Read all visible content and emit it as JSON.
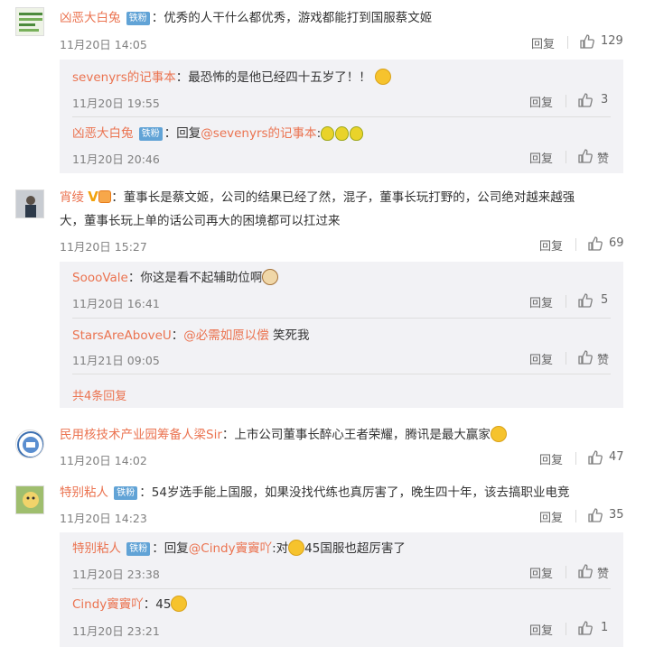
{
  "actions": {
    "reply": "回复",
    "like_text": "赞"
  },
  "comments": [
    {
      "user": "凶恶大白兔",
      "badge": "铁粉",
      "text": "优秀的人干什么都优秀，游戏都能打到国服蔡文姬",
      "time": "11月20日 14:05",
      "likes": "129",
      "replies": [
        {
          "user": "sevenyrs的记事本",
          "text": "最恐怖的是他已经四十五岁了！！",
          "time": "11月20日 19:55",
          "likes": "3"
        },
        {
          "user": "凶恶大白兔",
          "badge": "铁粉",
          "prefix": "回复",
          "at": "@sevenyrs的记事本",
          "text": ":",
          "time": "11月20日 20:46",
          "likes": "赞"
        }
      ]
    },
    {
      "user": "宵绫",
      "text_line1": "董事长是蔡文姬，公司的结果已经了然，混子，董事长玩打野的，公司绝对越来越强",
      "text_line2": "大，董事长玩上单的话公司再大的困境都可以扛过来",
      "time": "11月20日 15:27",
      "likes": "69",
      "replies": [
        {
          "user": "SoooVale",
          "text": "你这是看不起辅助位啊",
          "time": "11月20日 16:41",
          "likes": "5"
        },
        {
          "user": "StarsAreAboveU",
          "at": "@必需如愿以偿",
          "text": " 笑死我",
          "time": "11月21日 09:05",
          "likes": "赞"
        }
      ],
      "more": "共4条回复"
    },
    {
      "user": "民用核技术产业园筹备人梁Sir",
      "text": "上市公司董事长醉心王者荣耀，腾讯是最大赢家",
      "time": "11月20日 14:02",
      "likes": "47"
    },
    {
      "user": "特别粘人",
      "badge": "铁粉",
      "text": "54岁选手能上国服，如果没找代练也真厉害了，晚生四十年，该去搞职业电竞",
      "time": "11月20日 14:23",
      "likes": "35",
      "replies": [
        {
          "user": "特别粘人",
          "badge": "铁粉",
          "prefix": "回复",
          "at": "@Cindy竇竇吖",
          "text_a": ":对",
          "text_b": "45国服也超厉害了",
          "time": "11月20日 23:38",
          "likes": "赞"
        },
        {
          "user": "Cindy竇竇吖",
          "text": "45",
          "time": "11月20日 23:21",
          "likes": "1"
        }
      ]
    }
  ],
  "colors": {
    "username": "#eb7350",
    "badge": "#61a3d6",
    "subbox": "#f2f2f5",
    "meta": "#808080"
  }
}
